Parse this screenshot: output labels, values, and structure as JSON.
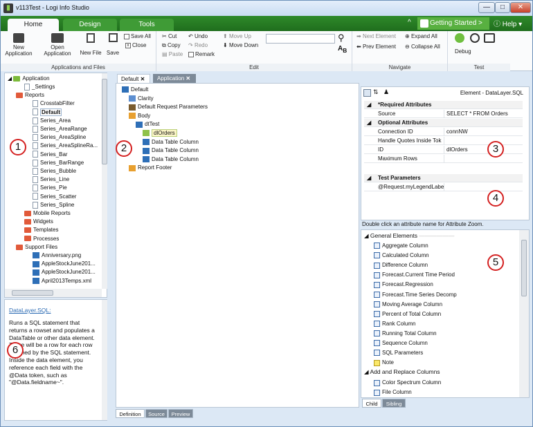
{
  "window": {
    "title": "v113Test - Logi Info Studio",
    "minimize": "—",
    "maximize": "□",
    "close": "✕"
  },
  "ribbon_tabs": [
    {
      "label": "Home",
      "active": true
    },
    {
      "label": "Design",
      "active": false
    },
    {
      "label": "Tools",
      "active": false
    }
  ],
  "getting_started": "Getting Started >",
  "help": "Help",
  "ribbon": {
    "app_group": {
      "label": "Applications and Files",
      "new_app_line1": "New",
      "new_app_line2": "Application",
      "open_app_line1": "Open",
      "open_app_line2": "Application",
      "new_file": "New File",
      "save": "Save",
      "save_all": "Save All",
      "close": "Close"
    },
    "edit_group": {
      "label": "Edit",
      "cut": "Cut",
      "copy": "Copy",
      "paste": "Paste",
      "undo": "Undo",
      "redo": "Redo",
      "remark": "Remark",
      "move_up": "Move Up",
      "move_down": "Move Down",
      "search_value": ""
    },
    "nav_group": {
      "label": "Navigate",
      "next": "Next Element",
      "prev": "Prev Element",
      "expand_all": "Expand All",
      "collapse_all": "Collapse All"
    },
    "test_group": {
      "label": "Test",
      "debug": "Debug"
    }
  },
  "app_tree": {
    "root": "Application",
    "items": [
      {
        "label": "_Settings",
        "type": "doc",
        "indent": 2
      },
      {
        "label": "Reports",
        "type": "folder",
        "indent": 1
      },
      {
        "label": "CrosstabFilter",
        "type": "doc",
        "indent": 3
      },
      {
        "label": "Default",
        "type": "doc",
        "indent": 3,
        "selected": true
      },
      {
        "label": "Series_Area",
        "type": "doc",
        "indent": 3
      },
      {
        "label": "Series_AreaRange",
        "type": "doc",
        "indent": 3
      },
      {
        "label": "Series_AreaSpline",
        "type": "doc",
        "indent": 3
      },
      {
        "label": "Series_AreaSplineRa...",
        "type": "doc",
        "indent": 3
      },
      {
        "label": "Series_Bar",
        "type": "doc",
        "indent": 3
      },
      {
        "label": "Series_BarRange",
        "type": "doc",
        "indent": 3
      },
      {
        "label": "Series_Bubble",
        "type": "doc",
        "indent": 3
      },
      {
        "label": "Series_Line",
        "type": "doc",
        "indent": 3
      },
      {
        "label": "Series_Pie",
        "type": "doc",
        "indent": 3
      },
      {
        "label": "Series_Scatter",
        "type": "doc",
        "indent": 3
      },
      {
        "label": "Series_Spline",
        "type": "doc",
        "indent": 3
      },
      {
        "label": "Mobile Reports",
        "type": "folder",
        "indent": 2
      },
      {
        "label": "Widgets",
        "type": "folder",
        "indent": 2
      },
      {
        "label": "Templates",
        "type": "folder",
        "indent": 2
      },
      {
        "label": "Processes",
        "type": "folder",
        "indent": 2
      },
      {
        "label": "Support Files",
        "type": "folder",
        "indent": 1
      },
      {
        "label": "Anniversary.png",
        "type": "img",
        "indent": 3
      },
      {
        "label": "AppleStockJune201...",
        "type": "img",
        "indent": 3
      },
      {
        "label": "AppleStockJune201...",
        "type": "img",
        "indent": 3
      },
      {
        "label": "April2013Temps.xml",
        "type": "img",
        "indent": 3
      }
    ]
  },
  "help_text": {
    "link": "DataLayer.SQL:",
    "body": "Runs a SQL statement that returns a rowset and populates a DataTable or other data element. There will be a row for each row returned by the SQL statement. Inside the data element, you reference each field with the @Data token, such as \"@Data.fieldname~\"."
  },
  "doc_tabs": [
    {
      "label": "Default",
      "active": true
    },
    {
      "label": "Application",
      "active": false
    }
  ],
  "def_tree": [
    {
      "label": "Default",
      "icon": "report",
      "level": 0
    },
    {
      "label": "Clarity",
      "icon": "theme",
      "level": 1
    },
    {
      "label": "Default Request Parameters",
      "icon": "params",
      "level": 1
    },
    {
      "label": "Body",
      "icon": "body",
      "level": 1
    },
    {
      "label": "dtTest",
      "icon": "grid",
      "level": 2
    },
    {
      "label": "dlOrders",
      "icon": "db",
      "level": 3,
      "selected": true
    },
    {
      "label": "Data Table Column",
      "icon": "grid",
      "level": 3
    },
    {
      "label": "Data Table Column",
      "icon": "grid",
      "level": 3
    },
    {
      "label": "Data Table Column",
      "icon": "grid",
      "level": 3
    },
    {
      "label": "Report Footer",
      "icon": "footer",
      "level": 1
    }
  ],
  "bottom_tabs": [
    "Definition",
    "Source",
    "Preview"
  ],
  "props": {
    "title": "Element - DataLayer.SQL",
    "required_label": "*Required Attributes",
    "optional_label": "Optional Attributes",
    "required": [
      {
        "k": "Source",
        "v": "SELECT * FROM Orders"
      }
    ],
    "optional": [
      {
        "k": "Connection ID",
        "v": "connNW"
      },
      {
        "k": "Handle Quotes Inside Tok",
        "v": ""
      },
      {
        "k": "ID",
        "v": "dlOrders"
      },
      {
        "k": "Maximum Rows",
        "v": ""
      }
    ],
    "test_label": "Test Parameters",
    "test_params": [
      {
        "k": "@Request.myLegendLabe",
        "v": ""
      }
    ],
    "hint": "Double click an attribute name for Attribute Zoom."
  },
  "elements": {
    "general_label": "General Elements",
    "general": [
      "Aggregate Column",
      "Calculated Column",
      "Difference Column",
      "Forecast.Current Time Period",
      "Forecast.Regression",
      "Forecast.Time Series Decomp",
      "Moving Average Column",
      "Percent of Total Column",
      "Rank Column",
      "Running Total Column",
      "Sequence Column",
      "SQL Parameters",
      "Note"
    ],
    "add_label": "Add and Replace Columns",
    "add": [
      "Color Spectrum Column",
      "File Column"
    ],
    "tabs": [
      "Child",
      "Sibling"
    ]
  },
  "callouts": [
    "1",
    "2",
    "3",
    "4",
    "5",
    "6"
  ],
  "colors": {
    "ribbon_green": "#2f8a2a",
    "folder_red": "#e15a3a",
    "accent_blue": "#2e6fb7",
    "callout_red": "#d42020"
  }
}
